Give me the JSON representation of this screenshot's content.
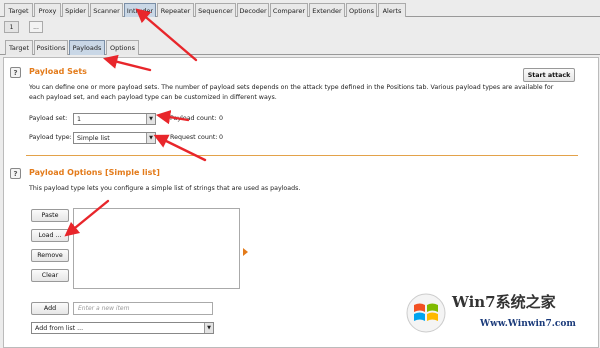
{
  "top_tabs": [
    "Target",
    "Proxy",
    "Spider",
    "Scanner",
    "Intruder",
    "Repeater",
    "Sequencer",
    "Decoder",
    "Comparer",
    "Extender",
    "Options",
    "Alerts"
  ],
  "request_tabs": [
    "1",
    "..."
  ],
  "sub_tabs": [
    "Target",
    "Positions",
    "Payloads",
    "Options"
  ],
  "payload_sets": {
    "title": "Payload Sets",
    "description_line1": "You can define one or more payload sets. The number of payload sets depends on the attack type defined in the Positions tab. Various payload types are available for",
    "description_line2": "each payload set, and each payload type can be customized in different ways.",
    "start_attack": "Start attack",
    "payload_set_label": "Payload set:",
    "payload_set_value": "1",
    "payload_count_label": "Payload count:",
    "payload_count": "0",
    "payload_type_label": "Payload type:",
    "payload_type_value": "Simple list",
    "request_count_label": "Request count:",
    "request_count": "0"
  },
  "payload_options": {
    "title": "Payload Options [Simple list]",
    "description": "This payload type lets you configure a simple list of strings that are used as payloads.",
    "buttons": [
      "Paste",
      "Load ...",
      "Remove",
      "Clear"
    ],
    "add_button": "Add",
    "new_item_placeholder": "Enter a new item",
    "add_from_list": "Add from list ..."
  },
  "help_glyph": "?",
  "watermark": {
    "brand_text": "Win7系统之家",
    "url": "Www.Winwin7.com"
  },
  "colors": {
    "section_title": "#e37b1b",
    "annotation_arrow": "#e8262b",
    "active_tab": "#c9d7e6"
  }
}
